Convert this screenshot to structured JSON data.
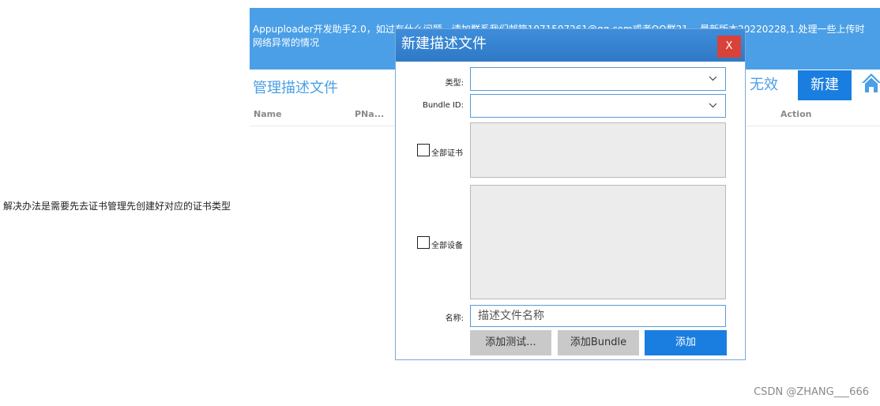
{
  "side_note": "解决办法是需要先去证书管理先创建好对应的证书类型",
  "watermark": "CSDN @ZHANG___666",
  "app": {
    "banner_line1": "Appuploader开发助手2.0，如过有什么问题，请加群系我们邮箱1071507261@qq.com或者QQ群21... 最新版本20220228,1.处理一些上传时",
    "banner_line2": "网络异常的情况",
    "page_title": "管理描述文件",
    "columns": [
      "Name",
      "PNa...",
      "Action"
    ],
    "btn_invalid": "无效",
    "btn_new": "新建",
    "home_icon": "home-icon"
  },
  "dialog": {
    "title": "新建描述文件",
    "close_label": "X",
    "type_label": "类型:",
    "type_value": "",
    "bundle_label": "Bundle ID:",
    "bundle_value": "",
    "all_certs_label": "全部证书",
    "all_devices_label": "全部设备",
    "name_label": "名称:",
    "name_placeholder": "描述文件名称",
    "btn_add_test": "添加测试...",
    "btn_add_bundle": "添加Bundle",
    "btn_add": "添加"
  },
  "colors": {
    "accent": "#4a9fe6",
    "primary_button": "#1a7ee0",
    "close_button": "#d9423a"
  }
}
